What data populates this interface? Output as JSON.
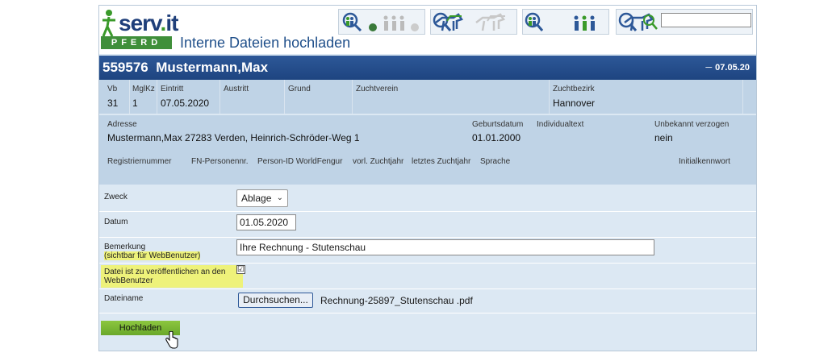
{
  "app": {
    "logo_text": "serv",
    "logo_dot": ".",
    "logo_suffix": "it",
    "module": "PFERD",
    "page_title": "Interne Dateien hochladen"
  },
  "header": {
    "record_id": "559576",
    "name": "Mustermann,Max",
    "date": "07.05.20"
  },
  "info_row1": {
    "labels": [
      "Vb",
      "MglKz",
      "Eintritt",
      "Austritt",
      "Grund",
      "Zuchtverein",
      "Zuchtbezirk"
    ],
    "values": [
      "31",
      "1",
      "07.05.2020",
      "",
      "",
      "",
      "Hannover"
    ]
  },
  "info_row2": {
    "address_label": "Adresse",
    "address_value": "Mustermann,Max 27283 Verden, Heinrich-Schröder-Weg 1",
    "birth_label": "Geburtsdatum",
    "birth_value": "01.01.2000",
    "individual_label": "Individualtext",
    "unknown_label": "Unbekannt verzogen",
    "unknown_value": "nein"
  },
  "info_row3": {
    "labels": [
      "Registriernummer",
      "FN-Personennr.",
      "Person-ID WorldFengur",
      "vorl. Zuchtjahr",
      "letztes Zuchtjahr",
      "Sprache",
      "Initialkennwort"
    ]
  },
  "form": {
    "zweck_label": "Zweck",
    "zweck_value": "Ablage",
    "datum_label": "Datum",
    "datum_value": "01.05.2020",
    "bemerkung_label": "Bemerkung",
    "bemerkung_sub": "(sichtbar für WebBenutzer)",
    "bemerkung_value": "Ihre Rechnung - Stutenschau",
    "publish_label_1": "Datei ist zu veröffentlichen an den",
    "publish_label_2": "WebBenutzer",
    "publish_checked": "☑",
    "dateiname_label": "Dateiname",
    "browse_label": "Durchsuchen...",
    "file_name": "Rechnung-25897_Stutenschau .pdf",
    "upload_label": "Hochladen"
  },
  "icons": [
    "persons-search-icon",
    "horses-icon",
    "person-group-icon",
    "horses-search-icon"
  ],
  "colors": {
    "header_blue": "#1e4480",
    "info_blue": "#bfd3e6",
    "form_bg": "#dce8f3",
    "highlight": "#eef27a",
    "upload_green": "#7ab833"
  }
}
